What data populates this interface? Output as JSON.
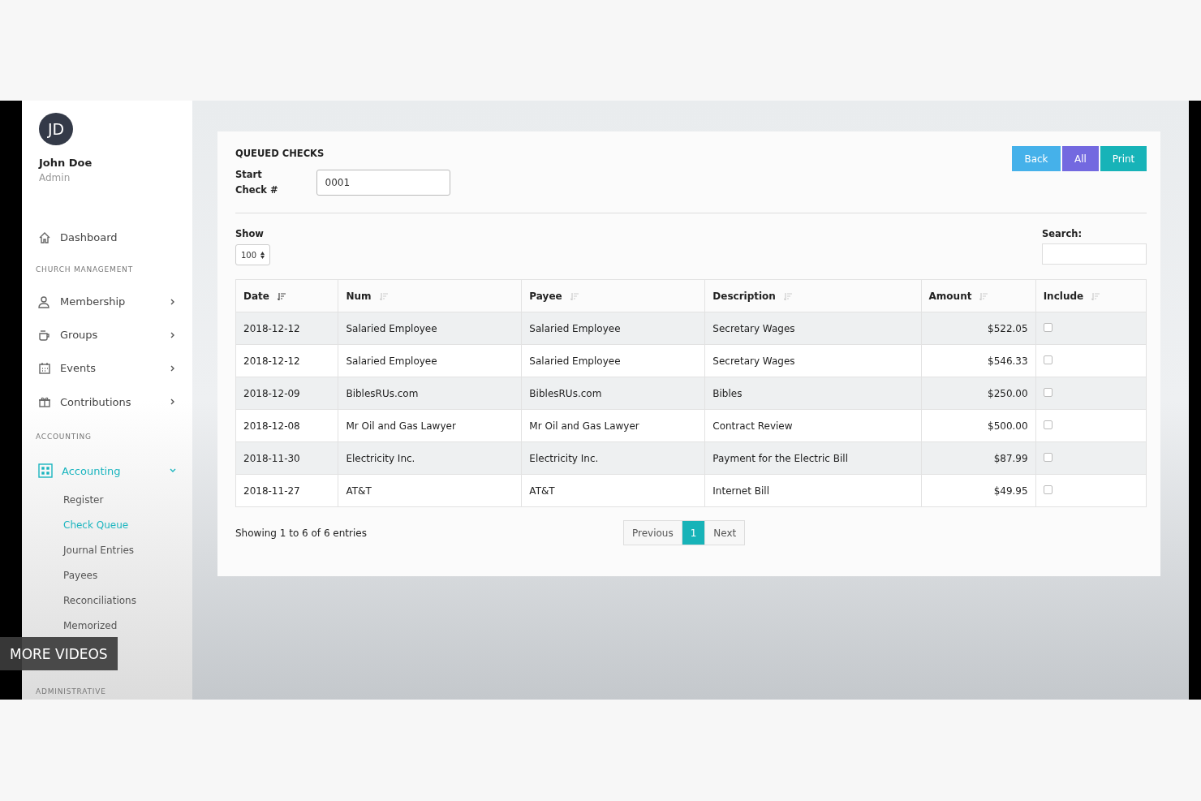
{
  "sidebar": {
    "user": {
      "initials": "JD",
      "name": "John Doe",
      "role": "Admin"
    },
    "nav": [
      {
        "kind": "link",
        "label": "Dashboard",
        "selected": false
      },
      {
        "kind": "section",
        "label": "CHURCH MANAGEMENT"
      },
      {
        "kind": "group",
        "label": "Membership",
        "selected": false,
        "expanded": false
      },
      {
        "kind": "group",
        "label": "Groups",
        "selected": false,
        "expanded": false
      },
      {
        "kind": "group",
        "label": "Events",
        "selected": false,
        "expanded": false
      },
      {
        "kind": "group",
        "label": "Contributions",
        "selected": false,
        "expanded": false
      },
      {
        "kind": "section",
        "label": "ACCOUNTING"
      },
      {
        "kind": "group",
        "label": "Accounting",
        "selected": true,
        "expanded": true,
        "children": [
          {
            "label": "Register",
            "selected": false
          },
          {
            "label": "Check Queue",
            "selected": true
          },
          {
            "label": "Journal Entries",
            "selected": false
          },
          {
            "label": "Payees",
            "selected": false
          },
          {
            "label": "Reconciliations",
            "selected": false
          },
          {
            "label": "Memorized",
            "selected": false
          }
        ]
      },
      {
        "kind": "section",
        "label": "ADMINISTRATIVE"
      }
    ]
  },
  "card": {
    "title": "QUEUED CHECKS",
    "buttons": [
      {
        "label": "Back",
        "color": "#45b1ea"
      },
      {
        "label": "All",
        "color": "#7369e0"
      },
      {
        "label": "Print",
        "color": "#17b3b8"
      }
    ],
    "start_check": {
      "label": "Start\nCheck #",
      "value": "0001"
    },
    "show": {
      "label": "Show",
      "value": "100"
    },
    "search": {
      "label": "Search:"
    }
  },
  "table": {
    "columns": [
      {
        "label": "Date",
        "sorted": true
      },
      {
        "label": "Num",
        "sorted": false
      },
      {
        "label": "Payee",
        "sorted": false
      },
      {
        "label": "Description",
        "sorted": false
      },
      {
        "label": "Amount",
        "sorted": false
      },
      {
        "label": "Include",
        "sorted": false
      }
    ],
    "rows": [
      {
        "date": "2018-12-12",
        "num": "Salaried Employee",
        "payee": "Salaried Employee",
        "description": "Secretary Wages",
        "amount": "$522.05",
        "include": false
      },
      {
        "date": "2018-12-12",
        "num": "Salaried Employee",
        "payee": "Salaried Employee",
        "description": "Secretary Wages",
        "amount": "$546.33",
        "include": false
      },
      {
        "date": "2018-12-09",
        "num": "BiblesRUs.com",
        "payee": "BiblesRUs.com",
        "description": "Bibles",
        "amount": "$250.00",
        "include": false
      },
      {
        "date": "2018-12-08",
        "num": "Mr Oil and Gas Lawyer",
        "payee": "Mr Oil and Gas Lawyer",
        "description": "Contract Review",
        "amount": "$500.00",
        "include": false
      },
      {
        "date": "2018-11-30",
        "num": "Electricity Inc.",
        "payee": "Electricity Inc.",
        "description": "Payment for the Electric Bill",
        "amount": "$87.99",
        "include": false
      },
      {
        "date": "2018-11-27",
        "num": "AT&T",
        "payee": "AT&T",
        "description": "Internet Bill",
        "amount": "$49.95",
        "include": false
      }
    ]
  },
  "footer": {
    "info": "Showing 1 to 6 of 6 entries",
    "pages": [
      {
        "label": "Previous",
        "selected": false
      },
      {
        "label": "1",
        "selected": true
      },
      {
        "label": "Next",
        "selected": false
      }
    ]
  },
  "overlay": {
    "label": "MORE VIDEOS"
  }
}
